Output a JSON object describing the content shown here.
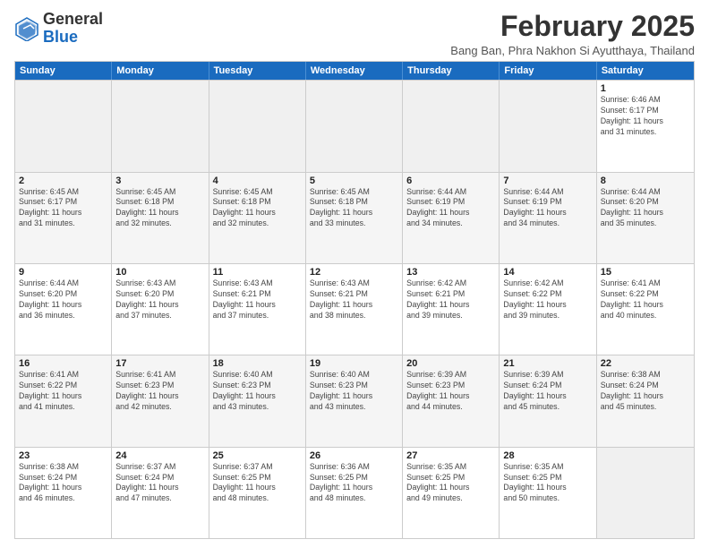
{
  "header": {
    "logo_general": "General",
    "logo_blue": "Blue",
    "month_title": "February 2025",
    "location": "Bang Ban, Phra Nakhon Si Ayutthaya, Thailand"
  },
  "weekdays": [
    "Sunday",
    "Monday",
    "Tuesday",
    "Wednesday",
    "Thursday",
    "Friday",
    "Saturday"
  ],
  "rows": [
    [
      {
        "day": "",
        "info": ""
      },
      {
        "day": "",
        "info": ""
      },
      {
        "day": "",
        "info": ""
      },
      {
        "day": "",
        "info": ""
      },
      {
        "day": "",
        "info": ""
      },
      {
        "day": "",
        "info": ""
      },
      {
        "day": "1",
        "info": "Sunrise: 6:46 AM\nSunset: 6:17 PM\nDaylight: 11 hours\nand 31 minutes."
      }
    ],
    [
      {
        "day": "2",
        "info": "Sunrise: 6:45 AM\nSunset: 6:17 PM\nDaylight: 11 hours\nand 31 minutes."
      },
      {
        "day": "3",
        "info": "Sunrise: 6:45 AM\nSunset: 6:18 PM\nDaylight: 11 hours\nand 32 minutes."
      },
      {
        "day": "4",
        "info": "Sunrise: 6:45 AM\nSunset: 6:18 PM\nDaylight: 11 hours\nand 32 minutes."
      },
      {
        "day": "5",
        "info": "Sunrise: 6:45 AM\nSunset: 6:18 PM\nDaylight: 11 hours\nand 33 minutes."
      },
      {
        "day": "6",
        "info": "Sunrise: 6:44 AM\nSunset: 6:19 PM\nDaylight: 11 hours\nand 34 minutes."
      },
      {
        "day": "7",
        "info": "Sunrise: 6:44 AM\nSunset: 6:19 PM\nDaylight: 11 hours\nand 34 minutes."
      },
      {
        "day": "8",
        "info": "Sunrise: 6:44 AM\nSunset: 6:20 PM\nDaylight: 11 hours\nand 35 minutes."
      }
    ],
    [
      {
        "day": "9",
        "info": "Sunrise: 6:44 AM\nSunset: 6:20 PM\nDaylight: 11 hours\nand 36 minutes."
      },
      {
        "day": "10",
        "info": "Sunrise: 6:43 AM\nSunset: 6:20 PM\nDaylight: 11 hours\nand 37 minutes."
      },
      {
        "day": "11",
        "info": "Sunrise: 6:43 AM\nSunset: 6:21 PM\nDaylight: 11 hours\nand 37 minutes."
      },
      {
        "day": "12",
        "info": "Sunrise: 6:43 AM\nSunset: 6:21 PM\nDaylight: 11 hours\nand 38 minutes."
      },
      {
        "day": "13",
        "info": "Sunrise: 6:42 AM\nSunset: 6:21 PM\nDaylight: 11 hours\nand 39 minutes."
      },
      {
        "day": "14",
        "info": "Sunrise: 6:42 AM\nSunset: 6:22 PM\nDaylight: 11 hours\nand 39 minutes."
      },
      {
        "day": "15",
        "info": "Sunrise: 6:41 AM\nSunset: 6:22 PM\nDaylight: 11 hours\nand 40 minutes."
      }
    ],
    [
      {
        "day": "16",
        "info": "Sunrise: 6:41 AM\nSunset: 6:22 PM\nDaylight: 11 hours\nand 41 minutes."
      },
      {
        "day": "17",
        "info": "Sunrise: 6:41 AM\nSunset: 6:23 PM\nDaylight: 11 hours\nand 42 minutes."
      },
      {
        "day": "18",
        "info": "Sunrise: 6:40 AM\nSunset: 6:23 PM\nDaylight: 11 hours\nand 43 minutes."
      },
      {
        "day": "19",
        "info": "Sunrise: 6:40 AM\nSunset: 6:23 PM\nDaylight: 11 hours\nand 43 minutes."
      },
      {
        "day": "20",
        "info": "Sunrise: 6:39 AM\nSunset: 6:23 PM\nDaylight: 11 hours\nand 44 minutes."
      },
      {
        "day": "21",
        "info": "Sunrise: 6:39 AM\nSunset: 6:24 PM\nDaylight: 11 hours\nand 45 minutes."
      },
      {
        "day": "22",
        "info": "Sunrise: 6:38 AM\nSunset: 6:24 PM\nDaylight: 11 hours\nand 45 minutes."
      }
    ],
    [
      {
        "day": "23",
        "info": "Sunrise: 6:38 AM\nSunset: 6:24 PM\nDaylight: 11 hours\nand 46 minutes."
      },
      {
        "day": "24",
        "info": "Sunrise: 6:37 AM\nSunset: 6:24 PM\nDaylight: 11 hours\nand 47 minutes."
      },
      {
        "day": "25",
        "info": "Sunrise: 6:37 AM\nSunset: 6:25 PM\nDaylight: 11 hours\nand 48 minutes."
      },
      {
        "day": "26",
        "info": "Sunrise: 6:36 AM\nSunset: 6:25 PM\nDaylight: 11 hours\nand 48 minutes."
      },
      {
        "day": "27",
        "info": "Sunrise: 6:35 AM\nSunset: 6:25 PM\nDaylight: 11 hours\nand 49 minutes."
      },
      {
        "day": "28",
        "info": "Sunrise: 6:35 AM\nSunset: 6:25 PM\nDaylight: 11 hours\nand 50 minutes."
      },
      {
        "day": "",
        "info": ""
      }
    ]
  ]
}
